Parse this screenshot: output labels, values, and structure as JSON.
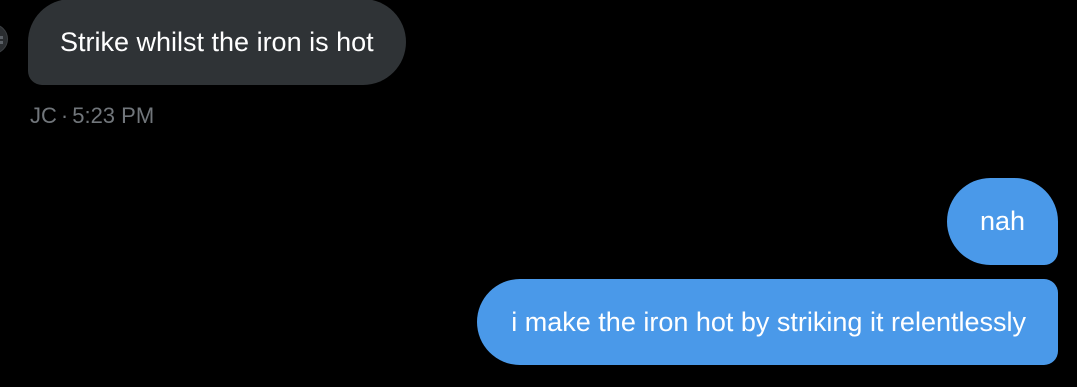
{
  "conversation": {
    "messages": [
      {
        "sender": "other",
        "text": "Strike whilst the iron is hot"
      },
      {
        "sender": "self",
        "text": "nah"
      },
      {
        "sender": "self",
        "text": "i make the iron hot by striking it relentlessly"
      }
    ],
    "meta": {
      "sender_initials": "JC",
      "separator": "·",
      "time": "5:23 PM"
    }
  },
  "colors": {
    "background": "#000000",
    "incoming_bubble": "#2f3336",
    "outgoing_bubble": "#4a99e9",
    "meta_text": "#71767b"
  },
  "icons": {
    "avatar": "user-avatar-icon"
  }
}
